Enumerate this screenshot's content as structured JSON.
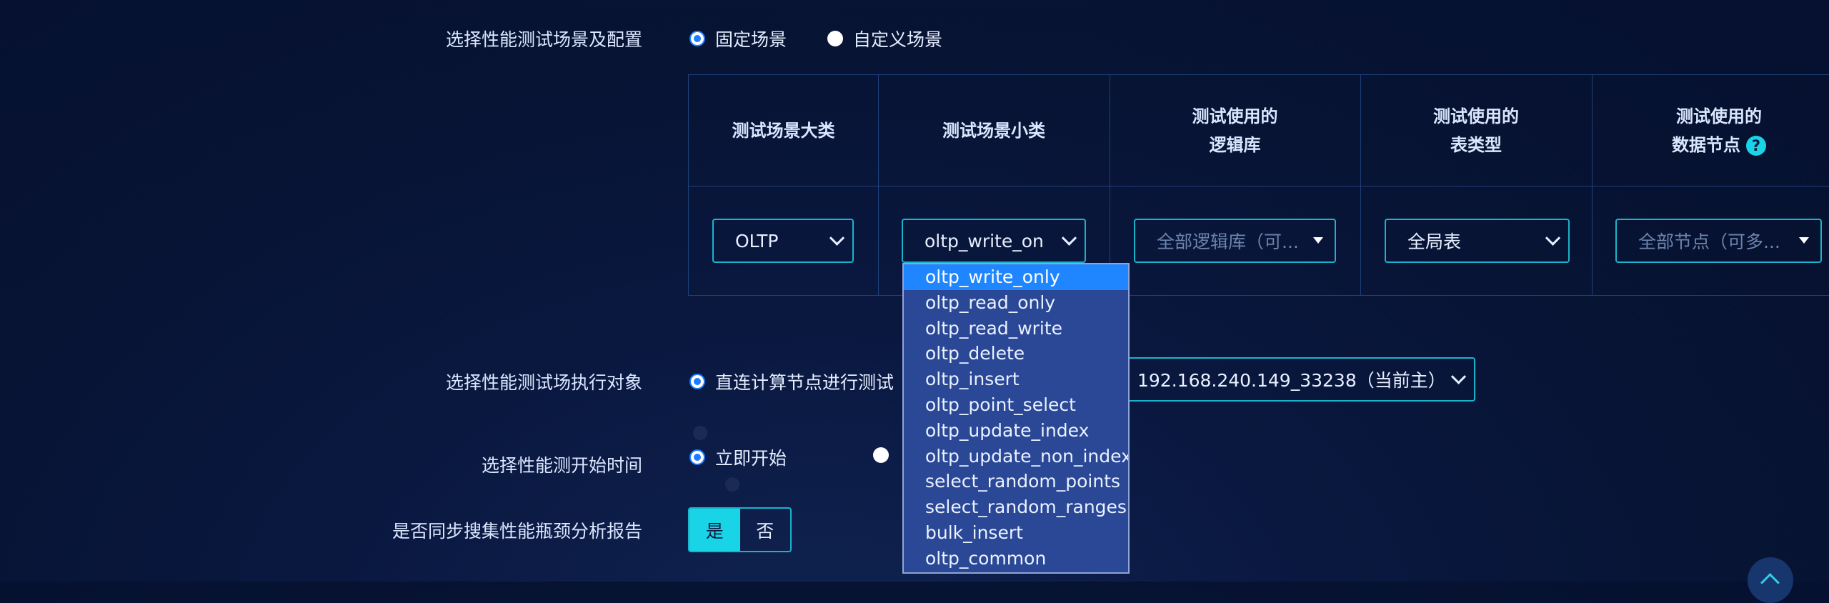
{
  "scenario": {
    "label": "选择性能测试场景及配置",
    "options": [
      "固定场景",
      "自定义场景"
    ],
    "selected": "固定场景"
  },
  "table": {
    "headers": {
      "category": "测试场景大类",
      "subcategory": "测试场景小类",
      "logic_db_l1": "测试使用的",
      "logic_db_l2": "逻辑库",
      "table_type_l1": "测试使用的",
      "table_type_l2": "表类型",
      "data_node_l1": "测试使用的",
      "data_node_l2": "数据节点"
    },
    "row": {
      "category": "OLTP",
      "subcategory": "oltp_write_on",
      "logic_db_placeholder": "全部逻辑库（可...",
      "table_type": "全局表",
      "data_node_placeholder": "全部节点（可多..."
    }
  },
  "dropdown": {
    "items": [
      "oltp_write_only",
      "oltp_read_only",
      "oltp_read_write",
      "oltp_delete",
      "oltp_insert",
      "oltp_point_select",
      "oltp_update_index",
      "oltp_update_non_index",
      "select_random_points",
      "select_random_ranges",
      "bulk_insert",
      "oltp_common"
    ],
    "highlighted": "oltp_write_only"
  },
  "target": {
    "label": "选择性能测试场执行对象",
    "option": "直连计算节点进行测试",
    "node_value": "192.168.240.149_33238（当前主）"
  },
  "start_time": {
    "label": "选择性能测开始时间",
    "option": "立即开始"
  },
  "report": {
    "label": "是否同步搜集性能瓶颈分析报告",
    "yes": "是",
    "no": "否",
    "selected": "是"
  },
  "icons": {
    "help": "question-circle-icon",
    "chevron": "chevron-down-icon",
    "caret": "caret-down-icon",
    "scroll_top": "arrow-up-icon"
  },
  "colors": {
    "accent": "#19d3e6",
    "border": "#19b4cc",
    "highlight": "#1f86ff",
    "dropdown_bg": "#2a4896"
  }
}
